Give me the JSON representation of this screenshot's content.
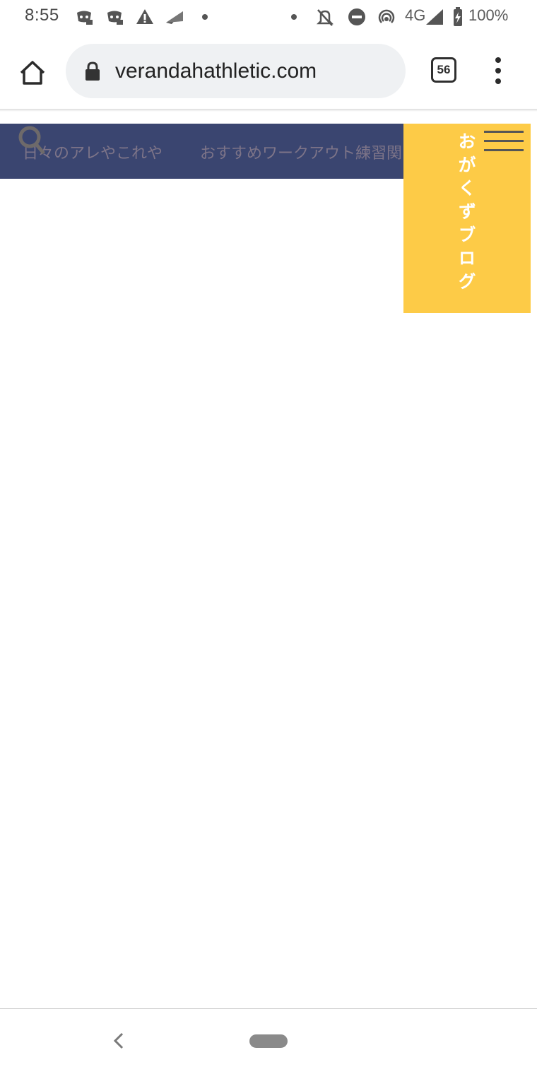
{
  "status_bar": {
    "time": "8:55",
    "network": "4G",
    "battery": "100%",
    "icons": [
      "discord-icon",
      "discord-icon",
      "warning-icon",
      "send-icon",
      "dot-icon",
      "dot-icon",
      "bell-off-icon",
      "do-not-disturb-icon",
      "hotspot-icon",
      "signal-icon",
      "battery-charging-icon"
    ]
  },
  "browser": {
    "url": "verandahathletic.com",
    "tab_count": "56"
  },
  "page": {
    "nav_items": [
      "日々のアレやこれや",
      "おすすめワークアウト練習関"
    ],
    "blog_title": "おがくずブログ",
    "colors": {
      "nav_background": "#3a4570",
      "side_panel": "#fdcb47"
    }
  }
}
